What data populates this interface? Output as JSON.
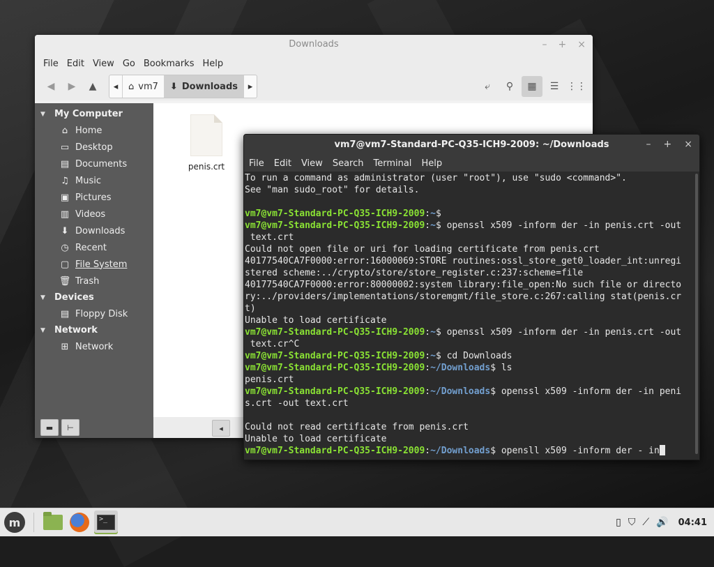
{
  "file_manager": {
    "title": "Downloads",
    "menu": [
      "File",
      "Edit",
      "View",
      "Go",
      "Bookmarks",
      "Help"
    ],
    "breadcrumb": {
      "home": "vm7",
      "current": "Downloads"
    },
    "sidebar": {
      "my_computer": {
        "heading": "My Computer",
        "items": [
          {
            "label": "Home",
            "icon": "home-icon"
          },
          {
            "label": "Desktop",
            "icon": "desktop-icon"
          },
          {
            "label": "Documents",
            "icon": "documents-icon"
          },
          {
            "label": "Music",
            "icon": "music-icon"
          },
          {
            "label": "Pictures",
            "icon": "pictures-icon"
          },
          {
            "label": "Videos",
            "icon": "videos-icon"
          },
          {
            "label": "Downloads",
            "icon": "downloads-icon"
          },
          {
            "label": "Recent",
            "icon": "recent-icon"
          },
          {
            "label": "File System",
            "icon": "filesystem-icon"
          },
          {
            "label": "Trash",
            "icon": "trash-icon"
          }
        ]
      },
      "devices": {
        "heading": "Devices",
        "items": [
          {
            "label": "Floppy Disk",
            "icon": "floppy-icon"
          }
        ]
      },
      "network": {
        "heading": "Network",
        "items": [
          {
            "label": "Network",
            "icon": "network-icon"
          }
        ]
      }
    },
    "files": [
      {
        "name": "penis.crt"
      }
    ]
  },
  "terminal": {
    "title": "vm7@vm7-Standard-PC-Q35-ICH9-2009: ~/Downloads",
    "menu": [
      "File",
      "Edit",
      "View",
      "Search",
      "Terminal",
      "Help"
    ],
    "prompt_user": "vm7@vm7-Standard-PC-Q35-ICH9-2009",
    "lines": [
      {
        "text": "To run a command as administrator (user \"root\"), use \"sudo <command>\"."
      },
      {
        "text": "See \"man sudo_root\" for details."
      },
      {
        "text": ""
      },
      {
        "path": "~",
        "cmd": ""
      },
      {
        "path": "~",
        "cmd": " openssl x509 -inform der -in penis.crt -out"
      },
      {
        "text": " text.crt"
      },
      {
        "text": "Could not open file or uri for loading certificate from penis.crt"
      },
      {
        "text": "40177540CA7F0000:error:16000069:STORE routines:ossl_store_get0_loader_int:unregi"
      },
      {
        "text": "stered scheme:../crypto/store/store_register.c:237:scheme=file"
      },
      {
        "text": "40177540CA7F0000:error:80000002:system library:file_open:No such file or directo"
      },
      {
        "text": "ry:../providers/implementations/storemgmt/file_store.c:267:calling stat(penis.cr"
      },
      {
        "text": "t)"
      },
      {
        "text": "Unable to load certificate"
      },
      {
        "path": "~",
        "cmd": " openssl x509 -inform der -in penis.crt -out"
      },
      {
        "text": " text.cr^C"
      },
      {
        "path": "~",
        "cmd": " cd Downloads"
      },
      {
        "path": "~/Downloads",
        "cmd": " ls"
      },
      {
        "text": "penis.crt"
      },
      {
        "path": "~/Downloads",
        "cmd": " openssl x509 -inform der -in peni"
      },
      {
        "text": "s.crt -out text.crt"
      },
      {
        "text": ""
      },
      {
        "text": "Could not read certificate from penis.crt"
      },
      {
        "text": "Unable to load certificate"
      },
      {
        "path": "~/Downloads",
        "cmd": " opensll x509 -inform der - in",
        "cursor": true
      }
    ]
  },
  "taskbar": {
    "clock": "04:41",
    "launchers": [
      "files-icon",
      "firefox-icon",
      "terminal-icon"
    ]
  }
}
